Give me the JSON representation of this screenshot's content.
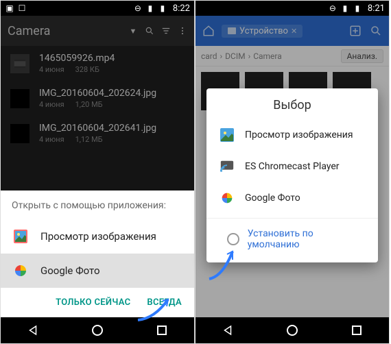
{
  "left": {
    "status_time": "8:22",
    "toolbar_title": "Camera",
    "files": [
      {
        "name": "1465059926.mp4",
        "date": "4 июня",
        "size": "328 КБ"
      },
      {
        "name": "IMG_20160604_202624.jpg",
        "date": "4 июня",
        "size": "1,20 МБ"
      },
      {
        "name": "IMG_20160604_202641.jpg",
        "date": "4 июня",
        "size": "1,12 МБ"
      }
    ],
    "chooser": {
      "title": "Открыть с помощью приложения:",
      "options": [
        {
          "label": "Просмотр изображения"
        },
        {
          "label": "Google Фото"
        }
      ],
      "just_once": "ТОЛЬКО СЕЙЧАС",
      "always": "ВСЕГДА"
    }
  },
  "right": {
    "status_time": "8:21",
    "device_chip": "Устройство",
    "crumbs": {
      "c1": "card",
      "c2": "DCIM",
      "c3": "Camera",
      "analyze": "Анализ."
    },
    "dialog": {
      "title": "Выбор",
      "options": [
        {
          "label": "Просмотр изображения"
        },
        {
          "label": "ES Chromecast Player"
        },
        {
          "label": "Google Фото"
        }
      ],
      "default_label": "Установить по умолчанию"
    }
  }
}
